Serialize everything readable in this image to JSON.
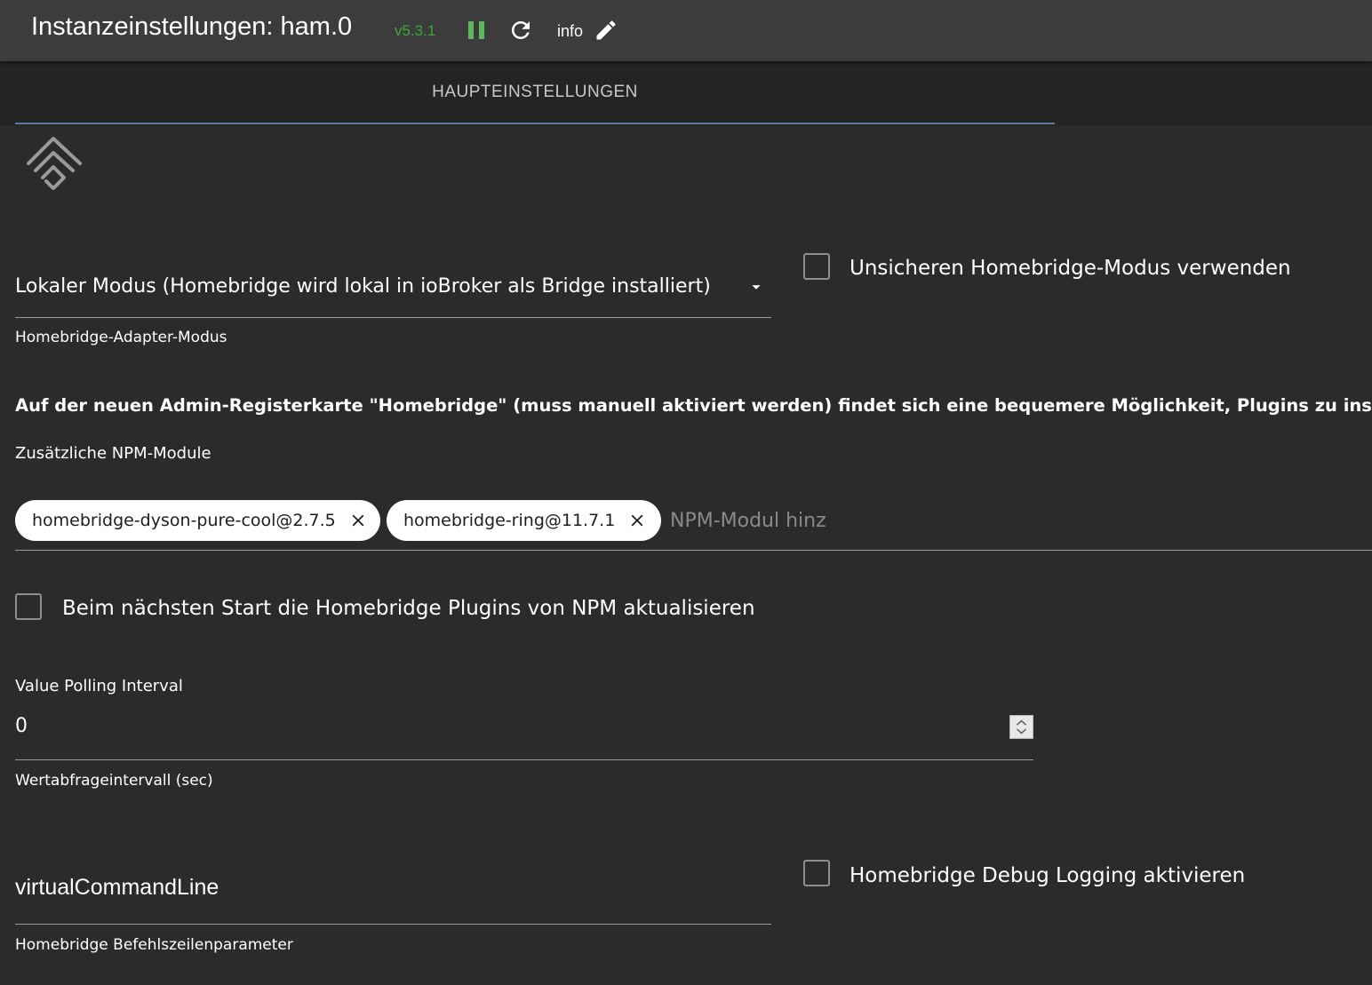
{
  "header": {
    "title": "Instanzeinstellungen: ham.0",
    "version": "v5.3.1",
    "info_label": "info",
    "pause_icon": "pause-icon",
    "reload_icon": "reload-icon",
    "edit_icon": "pencil-icon"
  },
  "tabs": [
    {
      "label": "HAUPTEINSTELLUNGEN",
      "active": true
    }
  ],
  "logo": "homebridge-logo-icon",
  "adapter_mode": {
    "value": "Lokaler Modus (Homebridge wird lokal in ioBroker als Bridge installiert)",
    "helper": "Homebridge-Adapter-Modus"
  },
  "insecure_mode": {
    "label": "Unsicheren Homebridge-Modus verwenden",
    "checked": false
  },
  "plugin_note": "Auf der neuen Admin-Registerkarte \"Homebridge\" (muss manuell aktiviert werden) findet sich eine bequemere Möglichkeit, Plugins zu install",
  "npm_modules": {
    "label": "Zusätzliche NPM-Module",
    "chips": [
      "homebridge-dyson-pure-cool@2.7.5",
      "homebridge-ring@11.7.1"
    ],
    "placeholder": "NPM-Modul hinz"
  },
  "update_plugins": {
    "label": "Beim nächsten Start die Homebridge Plugins von NPM aktualisieren",
    "checked": false
  },
  "polling_interval": {
    "label": "Value Polling Interval",
    "value": "0",
    "helper": "Wertabfrageintervall (sec)"
  },
  "command_line": {
    "value": "virtualCommandLine",
    "helper": "Homebridge Befehlszeilenparameter"
  },
  "debug_logging": {
    "label": "Homebridge Debug Logging aktivieren",
    "checked": false
  },
  "colors": {
    "background": "#2b2b2b",
    "topbar": "#3c3c3c",
    "tabbar": "#242424",
    "version": "#3aa63a",
    "pause": "#5cb85c",
    "tab_indicator": "#5f7b9a"
  }
}
